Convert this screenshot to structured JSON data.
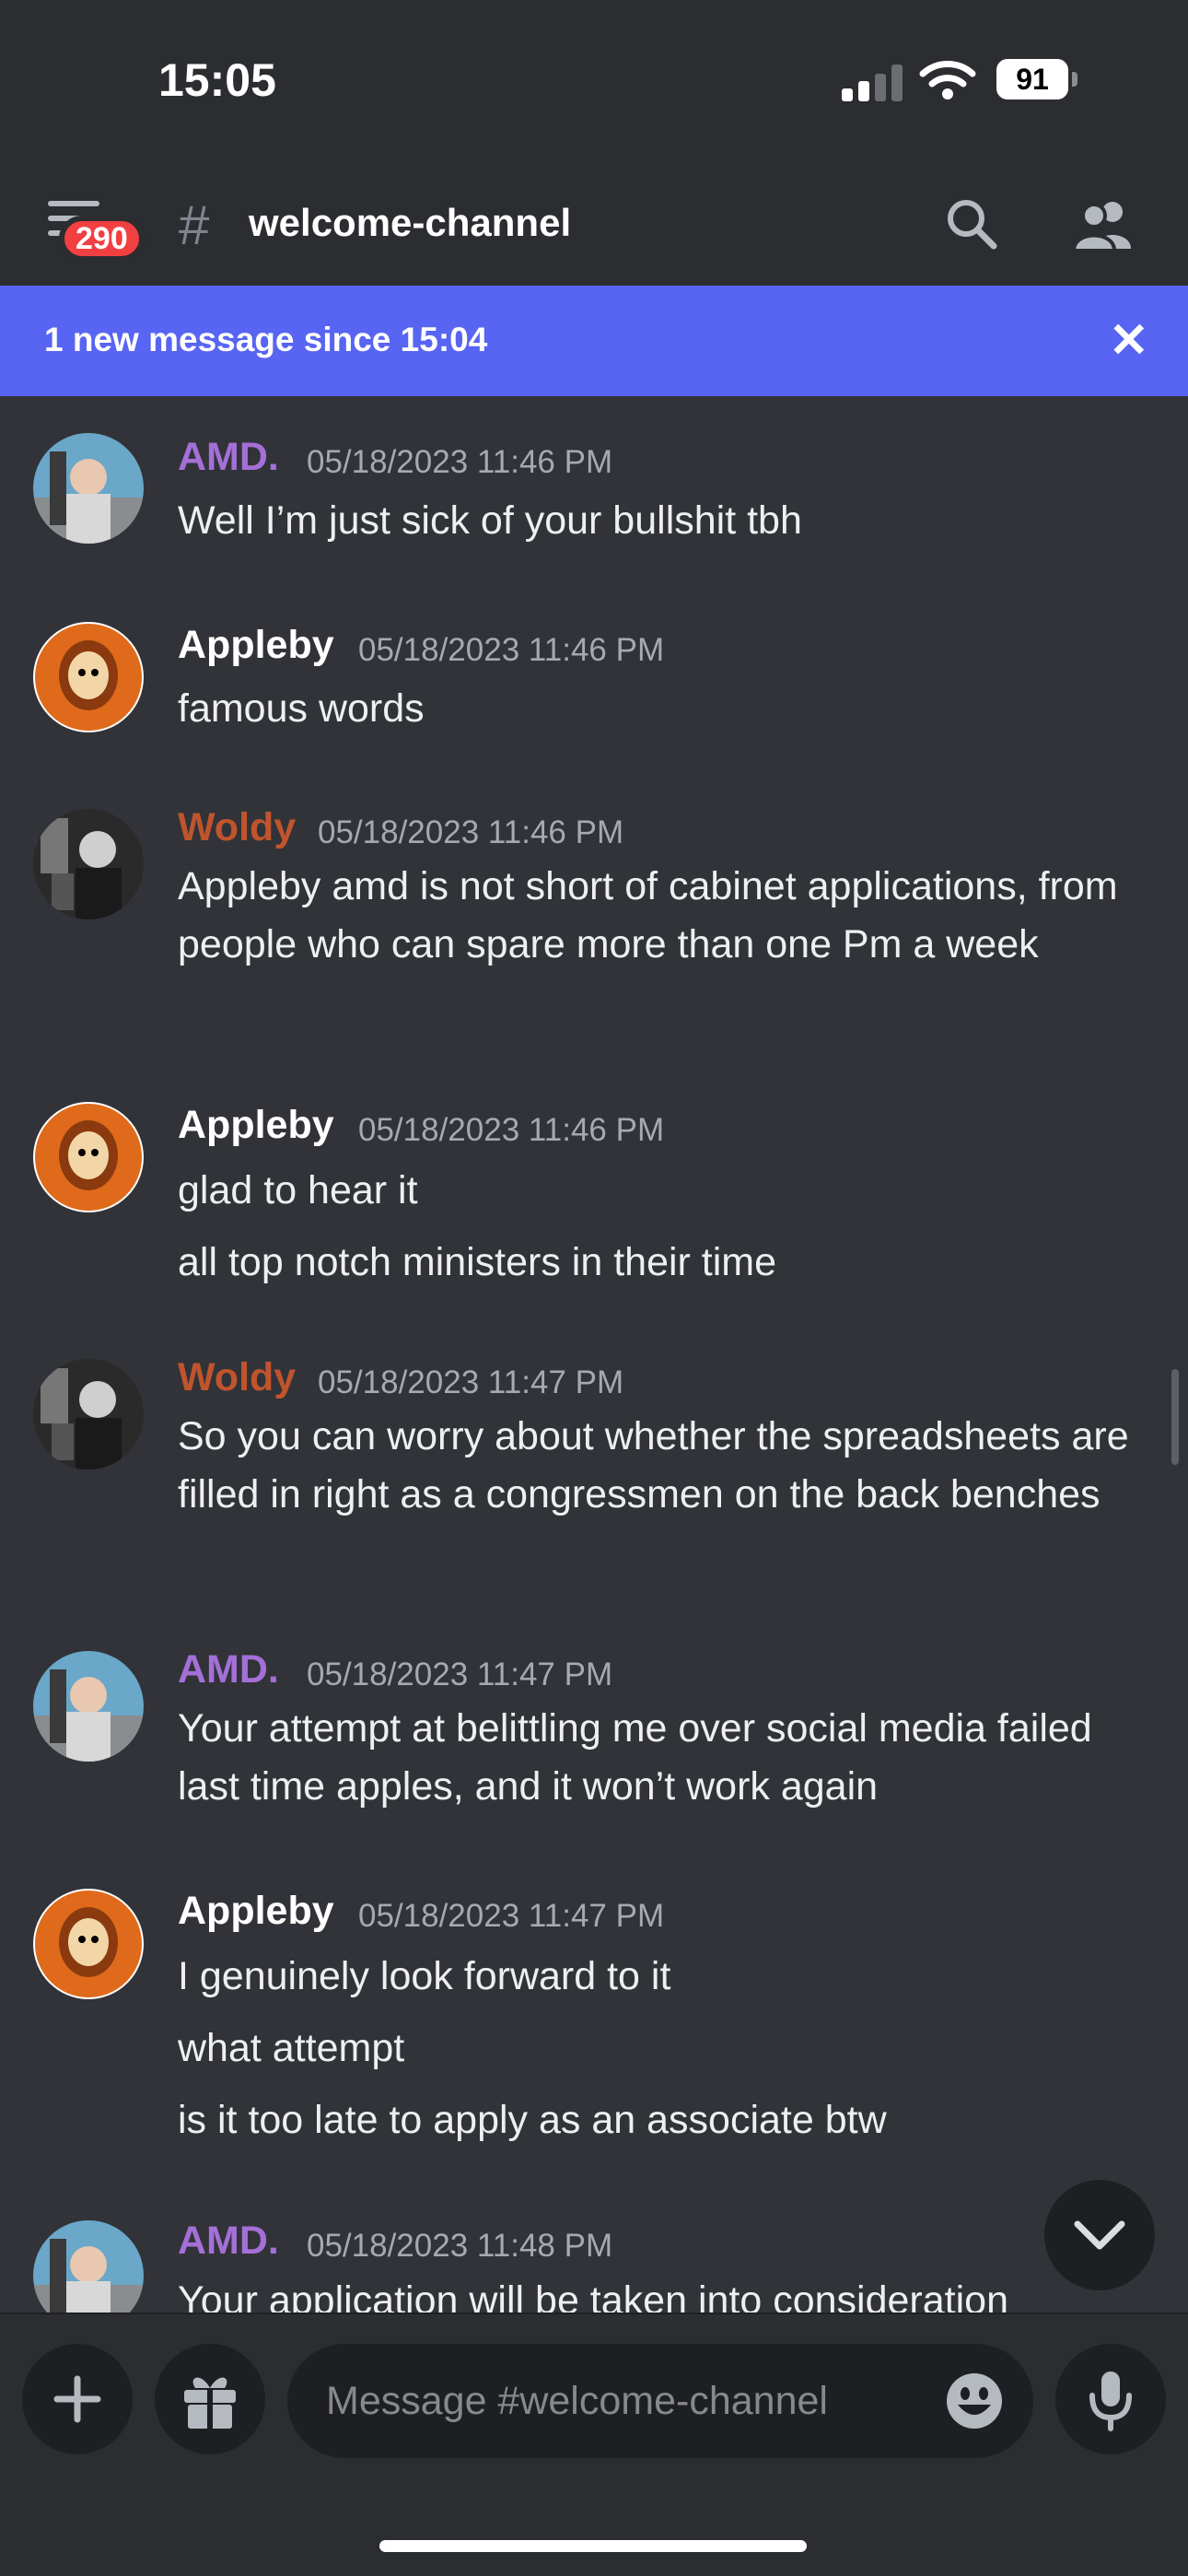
{
  "status_bar": {
    "time": "15:05",
    "battery": "91"
  },
  "header": {
    "unread_badge": "290",
    "hash": "#",
    "channel_name": "welcome-channel"
  },
  "new_message_bar": {
    "text": "1 new message since 15:04",
    "close": "✕"
  },
  "messages": [
    {
      "author": "AMD.",
      "timestamp": "05/18/2023 11:46 PM",
      "lines": [
        "Well I’m just sick of your bullshit tbh"
      ]
    },
    {
      "author": "Appleby",
      "timestamp": "05/18/2023 11:46 PM",
      "lines": [
        "famous words"
      ]
    },
    {
      "author": "Woldy",
      "timestamp": "05/18/2023 11:46 PM",
      "lines": [
        "Appleby amd is not short of cabinet applications, from people who can spare more than one Pm a week"
      ]
    },
    {
      "author": "Appleby",
      "timestamp": "05/18/2023 11:46 PM",
      "lines": [
        "glad to hear it",
        "all top notch ministers in their time"
      ]
    },
    {
      "author": "Woldy",
      "timestamp": "05/18/2023 11:47 PM",
      "lines": [
        "So you can worry about whether the spreadsheets are filled in right as a congressmen on the back benches"
      ]
    },
    {
      "author": "AMD.",
      "timestamp": "05/18/2023 11:47 PM",
      "lines": [
        "Your attempt at belittling me over social media failed last time apples, and it won’t work again"
      ]
    },
    {
      "author": "Appleby",
      "timestamp": "05/18/2023 11:47 PM",
      "lines": [
        "I genuinely look forward to it",
        "what attempt",
        "is it too late to apply as an associate btw"
      ]
    },
    {
      "author": "AMD.",
      "timestamp": "05/18/2023 11:48 PM",
      "lines": [
        "Your application will be taken into consideration"
      ]
    }
  ],
  "composer": {
    "placeholder": "Message #welcome-channel"
  },
  "colors": {
    "amd": "#a46fd7",
    "appleby": "#ffffff",
    "woldy": "#c0542c",
    "accent": "#5865f2"
  }
}
